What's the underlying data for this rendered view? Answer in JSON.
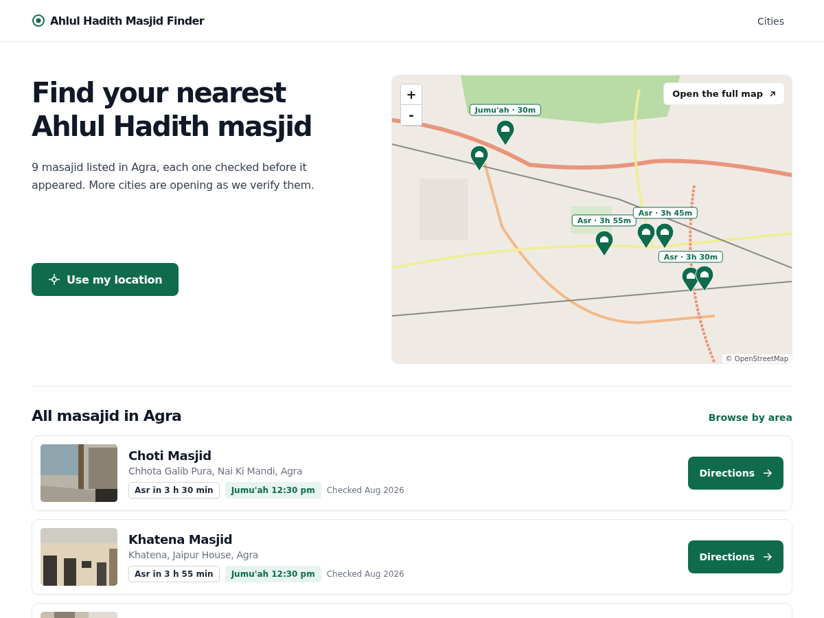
{
  "header": {
    "brand": "Ahlul Hadith Masjid Finder",
    "nav": [
      {
        "label": "Cities"
      }
    ]
  },
  "hero": {
    "title_lines": [
      "Find your nearest",
      "Ahlul Hadith masjid"
    ],
    "intro": "9 masajid listed in Agra, each one checked before it appeared. More cities are opening as we verify them.",
    "location_button": "Use my location"
  },
  "map": {
    "kind": "picture",
    "zoom_in": "+",
    "zoom_out": "-",
    "open_full_map": "Open the full map",
    "attribution": "© OpenStreetMap",
    "tooltips": [
      "Jumu'ah · 30m",
      "Asr · 3h 55m",
      "Asr · 3h 45m",
      "Asr · 3h 30m"
    ]
  },
  "list": {
    "title": "All masajid in Agra",
    "browse_link": "Browse by area",
    "masajid": [
      {
        "name": "Choti Masjid",
        "address": "Chhota Galib Pura, Nai Ki Mandi, Agra",
        "asr": "Asr in 3 h 30 min",
        "jumuah": "Jumu'ah 12:30 pm",
        "checked": "Checked Aug 2026",
        "button": "Directions"
      },
      {
        "name": "Khatena Masjid",
        "address": "Khatena, Jaipur House, Agra",
        "asr": "Asr in 3 h 55 min",
        "jumuah": "Jumu'ah 12:30 pm",
        "checked": "Checked Aug 2026",
        "button": "Directions"
      }
    ]
  }
}
